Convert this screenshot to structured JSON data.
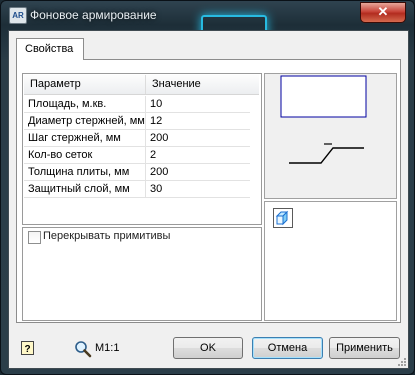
{
  "window": {
    "title": "Фоновое армирование",
    "app_icon": "AR",
    "close": "✕"
  },
  "tabs": [
    {
      "label": "Свойства"
    }
  ],
  "grid": {
    "headers": {
      "param": "Параметр",
      "value": "Значение"
    },
    "rows": [
      {
        "k": "Площадь, м.кв.",
        "v": "10"
      },
      {
        "k": "Диаметр стержней, мм",
        "v": "12"
      },
      {
        "k": "Шаг стержней, мм",
        "v": "200"
      },
      {
        "k": "Кол-во сеток",
        "v": "2"
      },
      {
        "k": "Толщина плиты, мм",
        "v": "200"
      },
      {
        "k": "Защитный слой, мм",
        "v": "30"
      }
    ]
  },
  "overlap": {
    "label": "Перекрывать примитивы",
    "checked": false
  },
  "footer": {
    "zoom": "M1:1",
    "ok": "OK",
    "cancel": "Отмена",
    "apply": "Применить"
  },
  "colors": {
    "preview_rect": "#0000a0",
    "accent_glow": "#29d3ff",
    "close": "#c8453a"
  },
  "icons": [
    "app-icon",
    "close-icon",
    "cube-icon",
    "help-icon",
    "zoom-icon",
    "resize-grip-icon"
  ]
}
